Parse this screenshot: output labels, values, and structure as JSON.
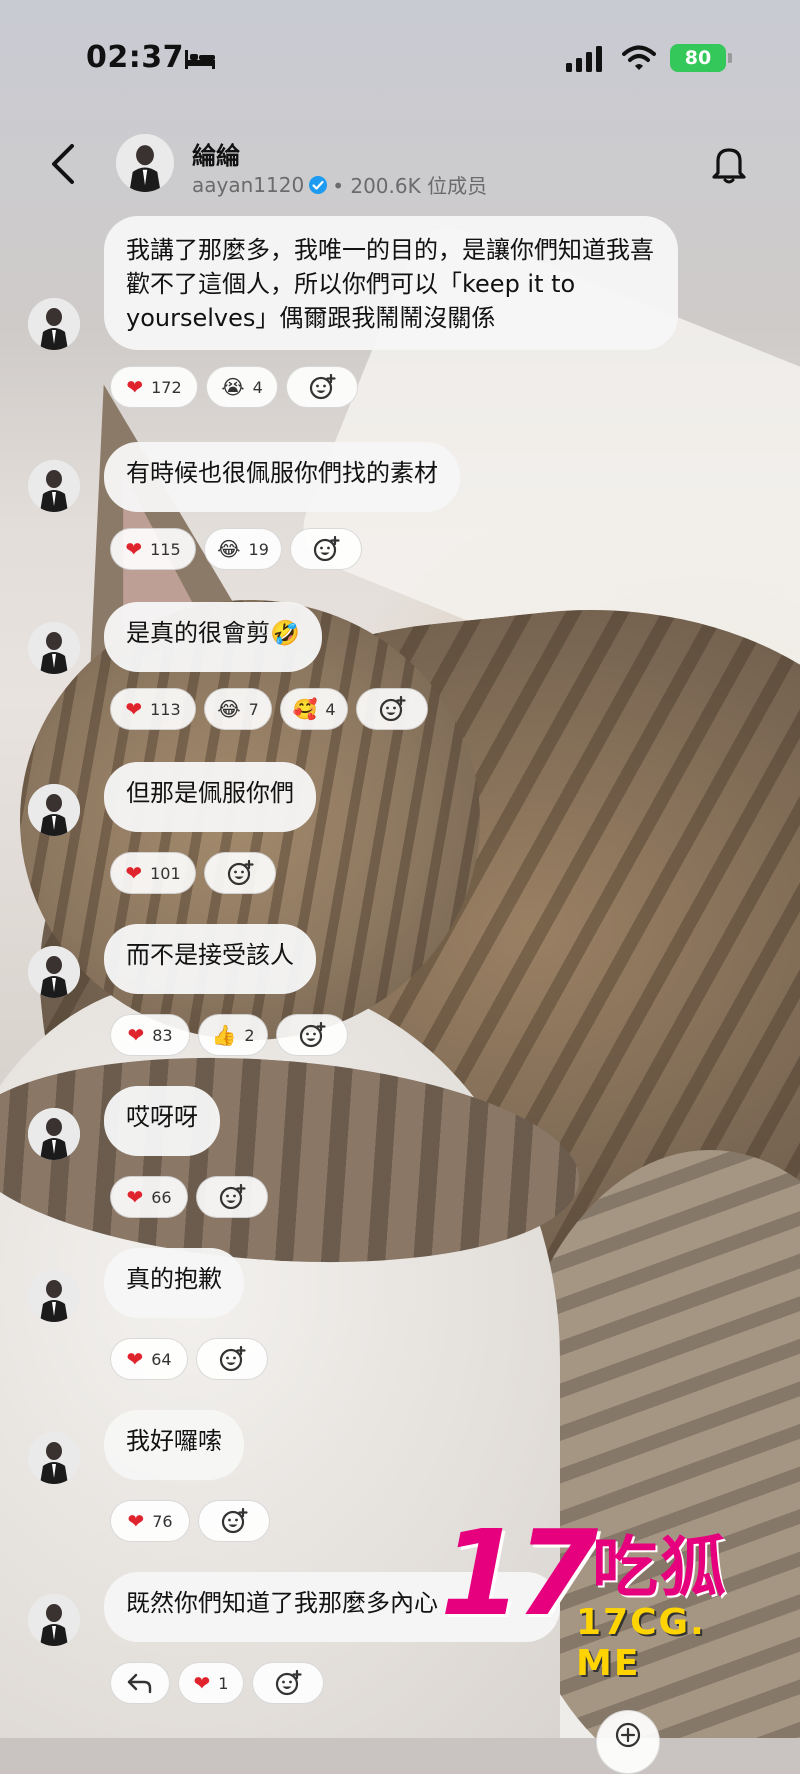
{
  "status_bar": {
    "time": "02:37",
    "battery": "80"
  },
  "header": {
    "channel_name": "綸綸",
    "handle": "aayan1120",
    "members": "• 200.6K 位成员"
  },
  "messages": [
    {
      "text": "我講了那麼多，我唯一的目的，是讓你們知道我喜歡不了這個人，所以你們可以「keep it to yourselves」偶爾跟我鬧鬧沒關係",
      "reactions": [
        {
          "emoji": "❤",
          "count": "172"
        },
        {
          "emoji": "😭",
          "count": "4"
        }
      ]
    },
    {
      "text": "有時候也很佩服你們找的素材",
      "reactions": [
        {
          "emoji": "❤",
          "count": "115"
        },
        {
          "emoji": "😂",
          "count": "19"
        }
      ]
    },
    {
      "text": "是真的很會剪🤣",
      "reactions": [
        {
          "emoji": "❤",
          "count": "113"
        },
        {
          "emoji": "😂",
          "count": "7"
        },
        {
          "emoji": "🥰",
          "count": "4"
        }
      ]
    },
    {
      "text": "但那是佩服你們",
      "reactions": [
        {
          "emoji": "❤",
          "count": "101"
        }
      ]
    },
    {
      "text": "而不是接受該人",
      "reactions": [
        {
          "emoji": "❤",
          "count": "83"
        },
        {
          "emoji": "👍",
          "count": "2"
        }
      ]
    },
    {
      "text": "哎呀呀",
      "reactions": [
        {
          "emoji": "❤",
          "count": "66"
        }
      ]
    },
    {
      "text": "真的抱歉",
      "reactions": [
        {
          "emoji": "❤",
          "count": "64"
        }
      ]
    },
    {
      "text": "我好囉嗦",
      "reactions": [
        {
          "emoji": "❤",
          "count": "76"
        }
      ]
    },
    {
      "text": "既然你們知道了我那麼多內心",
      "reactions": [
        {
          "emoji": "❤",
          "count": "1"
        }
      ]
    }
  ],
  "watermark": {
    "big": "17",
    "cn": "吃狐",
    "url": "17CG. ME"
  },
  "icons": [
    "bed-icon",
    "signal-icon",
    "wifi-icon",
    "back-icon",
    "verified-icon",
    "bell-icon",
    "add-reaction-icon",
    "reply-icon"
  ],
  "colors": {
    "battery": "#34c759",
    "heart": "#e0242e",
    "verified": "#1d9bf0",
    "watermark_pink": "#e6007e",
    "watermark_yellow": "#ffd400"
  }
}
